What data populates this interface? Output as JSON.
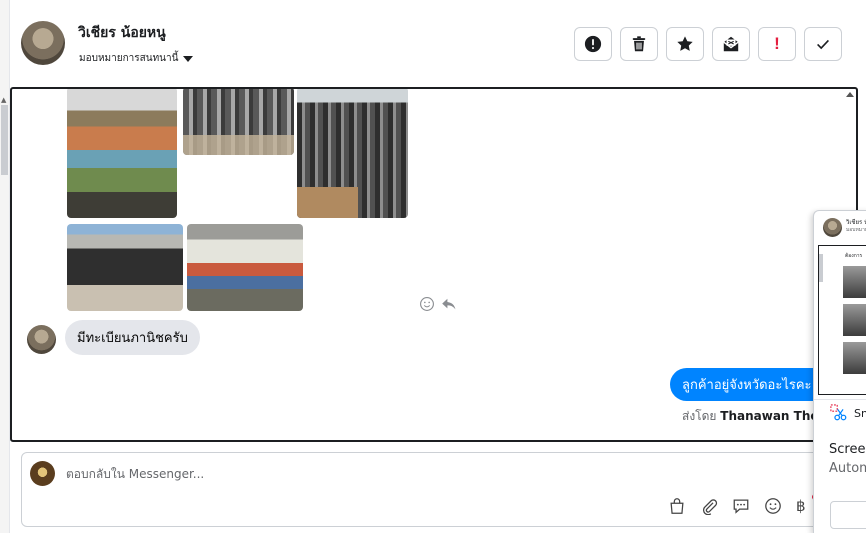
{
  "header": {
    "contact_name": "วิเชียร น้อยหนู",
    "assign_label": "มอบหมายการสนทนานี้",
    "tools": [
      {
        "icon": "exclamation-circle-icon",
        "label": "Mark as spam"
      },
      {
        "icon": "trash-icon",
        "label": "Delete"
      },
      {
        "icon": "star-icon",
        "label": "Star"
      },
      {
        "icon": "envelope-icon",
        "label": "Mark as unread"
      },
      {
        "icon": "exclamation-red-icon",
        "label": "Follow up"
      },
      {
        "icon": "check-icon",
        "label": "Done"
      }
    ],
    "follow_up_glyph": "!"
  },
  "conversation": {
    "photos": [
      {
        "alt": "shop shelf of rolled rims"
      },
      {
        "alt": "stacked steel rims"
      },
      {
        "alt": "rack of motorcycle wheel rims"
      },
      {
        "alt": "storefront with motorcycles"
      },
      {
        "alt": "shelves of motorcycle parts"
      }
    ],
    "incoming_message": "มีทะเบียนภานิชครับ",
    "outgoing_message": "ลูกค้าอยู่จังหวัดอะไรคะ",
    "sent_by_prefix": "ส่งโดย",
    "sent_by_name": "Thanawan Thon"
  },
  "composer": {
    "placeholder": "ตอบกลับใน Messenger...",
    "value": "",
    "tools": [
      "shopping-bag-icon",
      "paperclip-icon",
      "saved-reply-icon",
      "emoji-icon",
      "baht-icon"
    ],
    "baht_glyph": "฿"
  },
  "overlay": {
    "name": "วิเชียร น้อยหนู",
    "subtitle": "มอบหมาย",
    "thumb_label": "ต้องการ",
    "app_label": "Sn",
    "title": "Screen",
    "description": "Autom"
  },
  "colors": {
    "accent": "#0084ff",
    "follow_up_red": "#e41e3f",
    "bubble_gray": "#e4e6eb"
  }
}
